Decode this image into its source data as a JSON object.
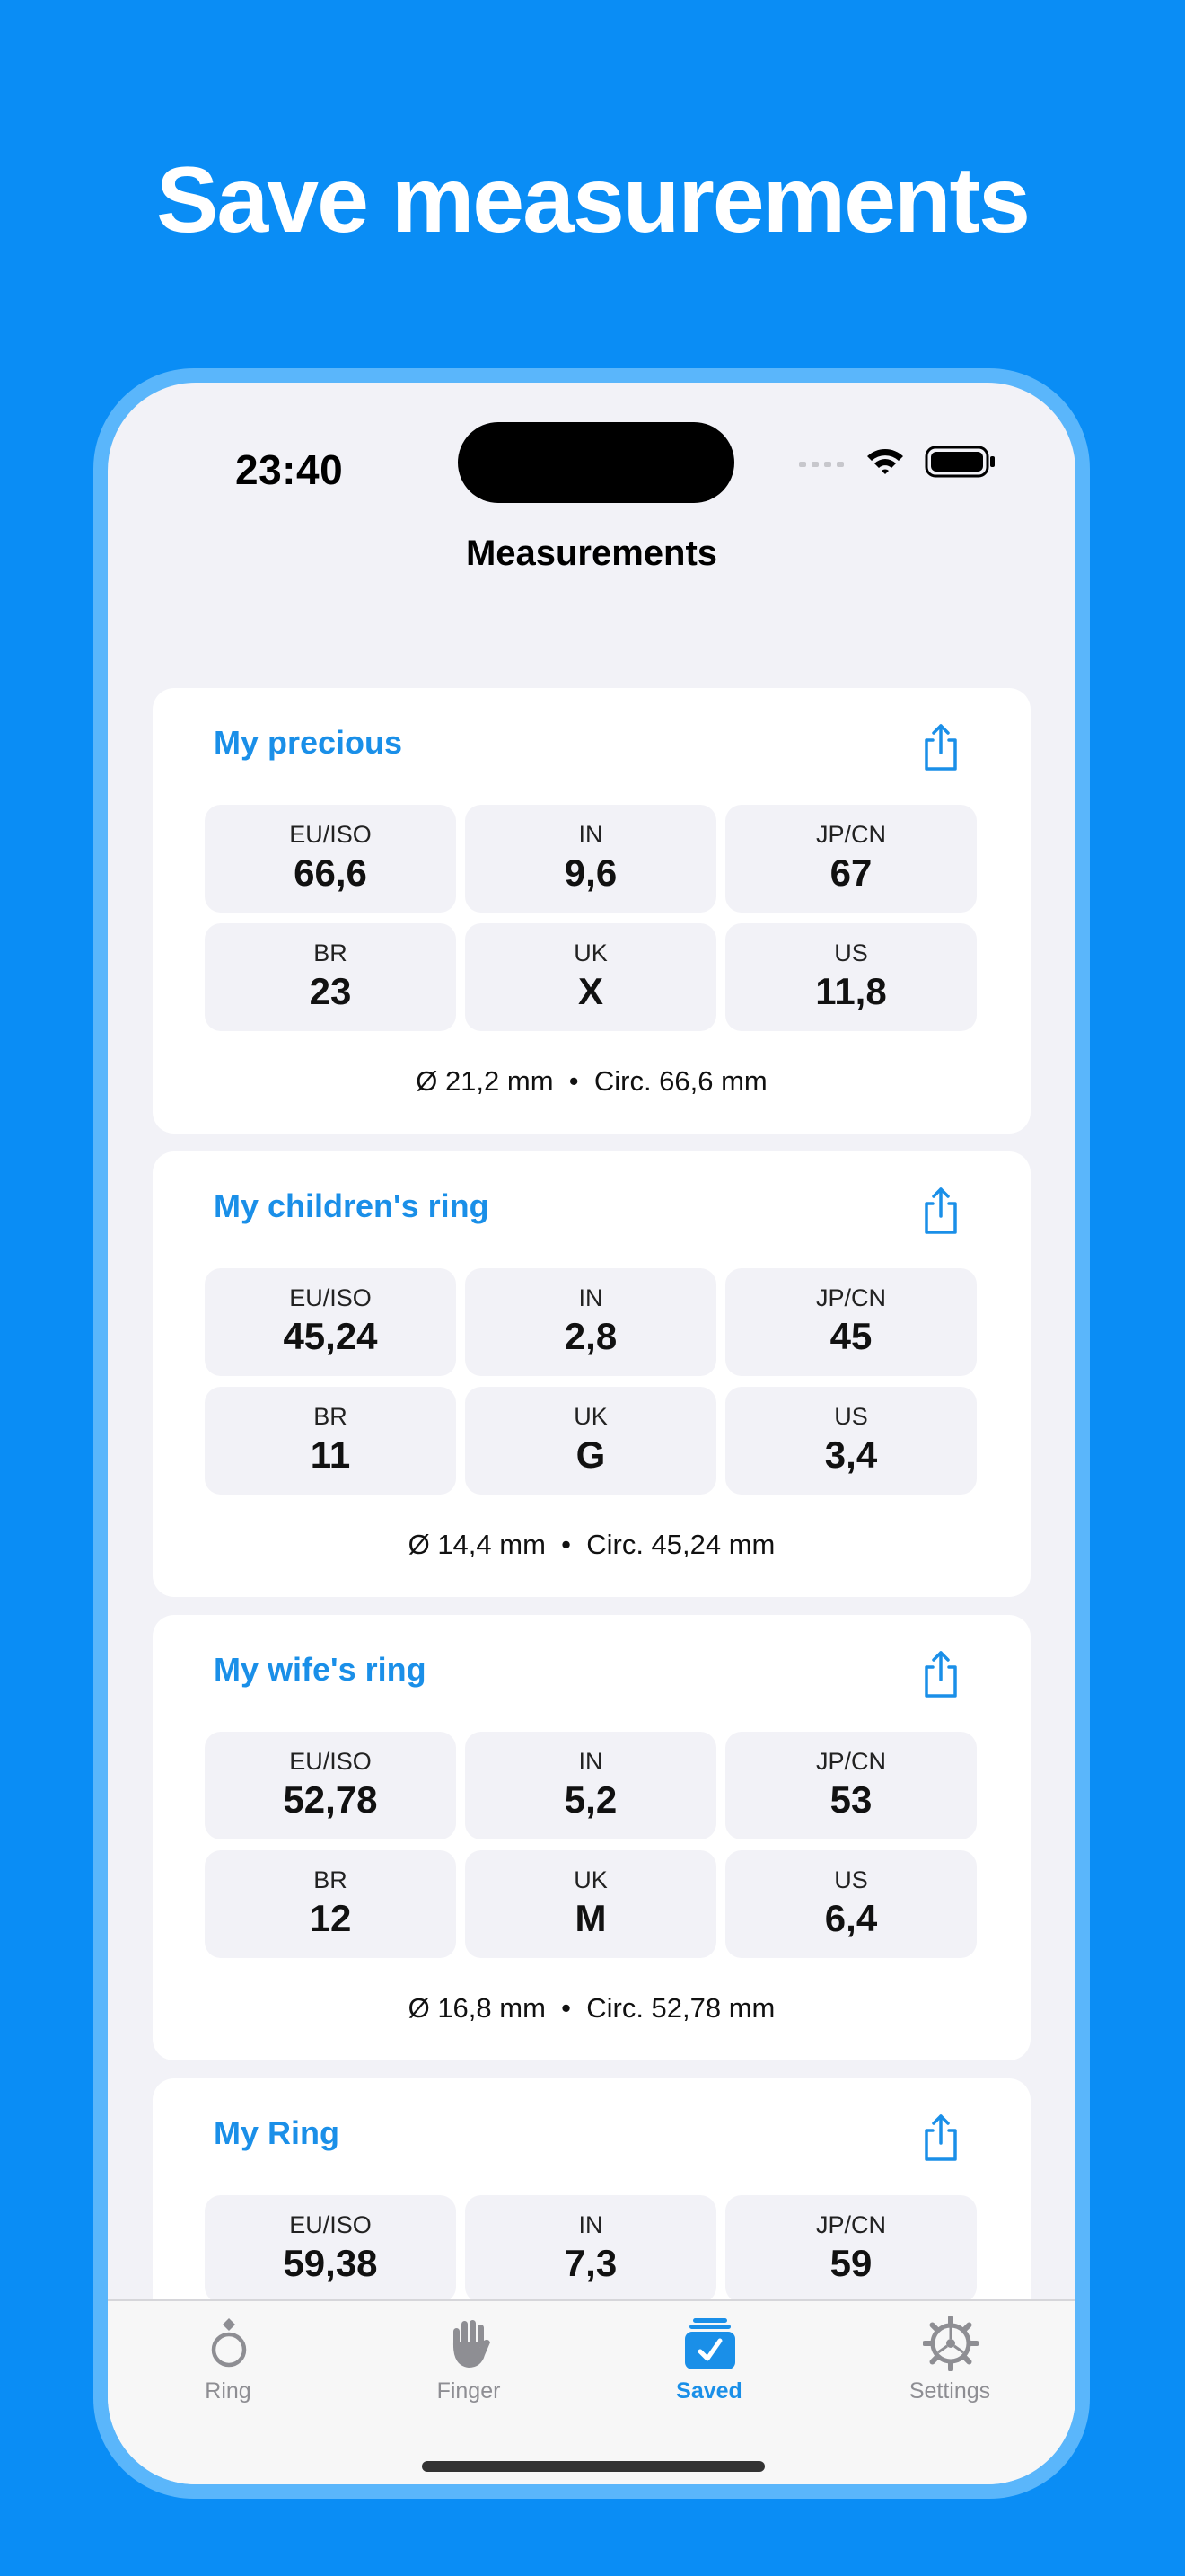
{
  "headline": "Save measurements",
  "status_bar": {
    "time": "23:40"
  },
  "nav": {
    "title": "Measurements"
  },
  "cards": [
    {
      "title": "My precious",
      "cells": [
        {
          "label": "EU/ISO",
          "value": "66,6"
        },
        {
          "label": "IN",
          "value": "9,6"
        },
        {
          "label": "JP/CN",
          "value": "67"
        },
        {
          "label": "BR",
          "value": "23"
        },
        {
          "label": "UK",
          "value": "X"
        },
        {
          "label": "US",
          "value": "11,8"
        }
      ],
      "footer": "Ø 21,2 mm  •  Circ. 66,6 mm"
    },
    {
      "title": "My children's ring",
      "cells": [
        {
          "label": "EU/ISO",
          "value": "45,24"
        },
        {
          "label": "IN",
          "value": "2,8"
        },
        {
          "label": "JP/CN",
          "value": "45"
        },
        {
          "label": "BR",
          "value": "11"
        },
        {
          "label": "UK",
          "value": "G"
        },
        {
          "label": "US",
          "value": "3,4"
        }
      ],
      "footer": "Ø 14,4 mm  •  Circ. 45,24 mm"
    },
    {
      "title": "My wife's ring",
      "cells": [
        {
          "label": "EU/ISO",
          "value": "52,78"
        },
        {
          "label": "IN",
          "value": "5,2"
        },
        {
          "label": "JP/CN",
          "value": "53"
        },
        {
          "label": "BR",
          "value": "12"
        },
        {
          "label": "UK",
          "value": "M"
        },
        {
          "label": "US",
          "value": "6,4"
        }
      ],
      "footer": "Ø 16,8 mm  •  Circ. 52,78 mm"
    },
    {
      "title": "My Ring",
      "cells": [
        {
          "label": "EU/ISO",
          "value": "59,38"
        },
        {
          "label": "IN",
          "value": "7,3"
        },
        {
          "label": "JP/CN",
          "value": "59"
        }
      ],
      "footer": ""
    }
  ],
  "tabs": [
    {
      "label": "Ring",
      "icon": "ring-icon",
      "active": false
    },
    {
      "label": "Finger",
      "icon": "hand-icon",
      "active": false
    },
    {
      "label": "Saved",
      "icon": "saved-checklist-icon",
      "active": true
    },
    {
      "label": "Settings",
      "icon": "gear-icon",
      "active": false
    }
  ],
  "colors": {
    "background": "#0a8df5",
    "accent": "#1a8fe8",
    "screen": "#f2f2f7",
    "cell": "#f2f2f7",
    "inactive_tab": "#8e8e93"
  }
}
